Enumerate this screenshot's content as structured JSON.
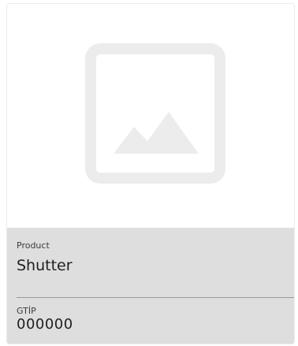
{
  "card": {
    "image": {
      "icon": "image-placeholder-icon",
      "icon_color": "#ececec"
    },
    "product": {
      "label": "Product",
      "name": "Shutter"
    },
    "gtip": {
      "label": "GTİP",
      "value": "000000"
    }
  }
}
